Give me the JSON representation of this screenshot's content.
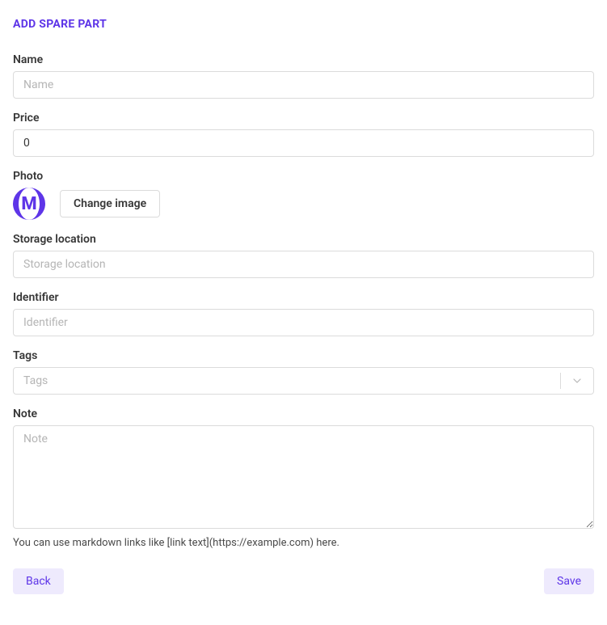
{
  "page_title": "ADD SPARE PART",
  "fields": {
    "name": {
      "label": "Name",
      "placeholder": "Name",
      "value": ""
    },
    "price": {
      "label": "Price",
      "value": "0"
    },
    "photo": {
      "label": "Photo",
      "logo_letter": "M",
      "change_button": "Change image"
    },
    "storage_location": {
      "label": "Storage location",
      "placeholder": "Storage location",
      "value": ""
    },
    "identifier": {
      "label": "Identifier",
      "placeholder": "Identifier",
      "value": ""
    },
    "tags": {
      "label": "Tags",
      "placeholder": "Tags"
    },
    "note": {
      "label": "Note",
      "placeholder": "Note",
      "value": "",
      "help_text": "You can use markdown links like [link text](https://example.com) here."
    }
  },
  "buttons": {
    "back": "Back",
    "save": "Save"
  }
}
